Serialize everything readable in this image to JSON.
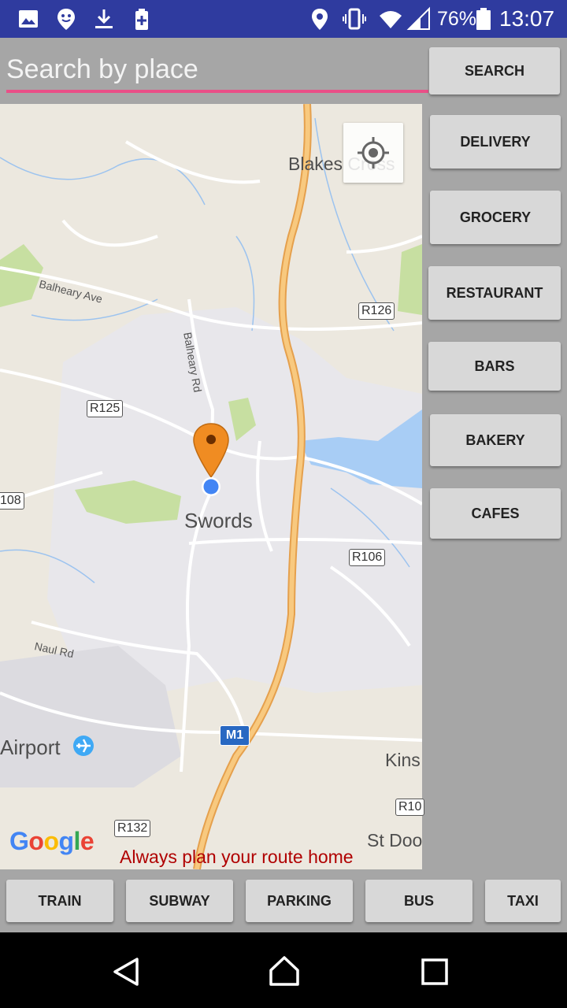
{
  "status_bar": {
    "battery_percent": "76%",
    "time": "13:07",
    "icons": [
      "image-icon",
      "location-pin-icon",
      "download-icon",
      "battery-saver-icon",
      "location-icon",
      "vibrate-icon",
      "wifi-icon",
      "signal-icon",
      "battery-icon"
    ]
  },
  "search": {
    "placeholder": "Search by place",
    "value": "",
    "button_label": "SEARCH"
  },
  "categories": [
    {
      "label": "DELIVERY"
    },
    {
      "label": "GROCERY"
    },
    {
      "label": "RESTAURANT"
    },
    {
      "label": "BARS"
    },
    {
      "label": "BAKERY"
    },
    {
      "label": "CAFES"
    }
  ],
  "map": {
    "place_labels": [
      "Blakes Cross",
      "Swords",
      "Airport",
      "Kins",
      "St Doo"
    ],
    "road_labels": [
      "R126",
      "R125",
      "108",
      "R106",
      "R132",
      "R10"
    ],
    "street_labels": [
      "Balheary Ave",
      "Balheary Rd",
      "Naul Rd"
    ],
    "motorway_label": "M1",
    "attribution": "Google",
    "overlay_message": "Always plan your route home",
    "colors": {
      "motorway": "#f4b85d",
      "water": "#a8cdf5",
      "park": "#c7dfa1",
      "urban": "#e7e6ea",
      "marker": "#f08c22",
      "my_location": "#4285f4"
    }
  },
  "transport": [
    {
      "label": "TRAIN"
    },
    {
      "label": "SUBWAY"
    },
    {
      "label": "PARKING"
    },
    {
      "label": "BUS"
    },
    {
      "label": "TAXI"
    }
  ],
  "nav": {
    "icons": [
      "back-icon",
      "home-icon",
      "recents-icon"
    ]
  }
}
